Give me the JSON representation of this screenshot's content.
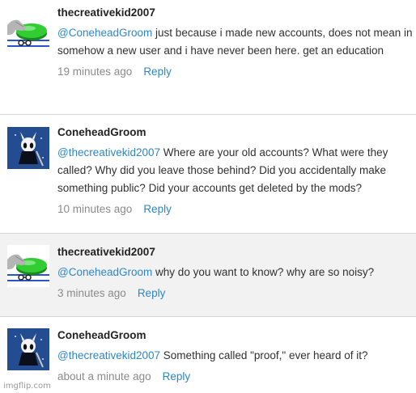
{
  "comments": [
    {
      "username": "thecreativekid2007",
      "mention": "@ConeheadGroom",
      "text": "just because i made new accounts, does not mean in somehow a new user and i have never been here. get an education",
      "time": "19 minutes ago",
      "reply_label": "Reply",
      "avatar_icon": "green-button-hand-icon"
    },
    {
      "username": "ConeheadGroom",
      "mention": "@thecreativekid2007",
      "text": "Where are your old accounts? What were they called? Why did you leave those behind? Did you accidentally make something public? Did your accounts get deleted by the mods?",
      "time": "10 minutes ago",
      "reply_label": "Reply",
      "avatar_icon": "hollow-knight-icon"
    },
    {
      "username": "thecreativekid2007",
      "mention": "@ConeheadGroom",
      "text": "why do you want to know? why are so noisy?",
      "time": "3 minutes ago",
      "reply_label": "Reply",
      "avatar_icon": "green-button-hand-icon"
    },
    {
      "username": "ConeheadGroom",
      "mention": "@thecreativekid2007",
      "text": "Something called \"proof,\" ever heard of it?",
      "time": "about a minute ago",
      "reply_label": "Reply",
      "avatar_icon": "hollow-knight-icon"
    }
  ],
  "watermark": "imgflip.com",
  "colors": {
    "link": "#2e86c7",
    "shaded_row": "#f2f2f2",
    "divider": "#d6d6d6"
  }
}
